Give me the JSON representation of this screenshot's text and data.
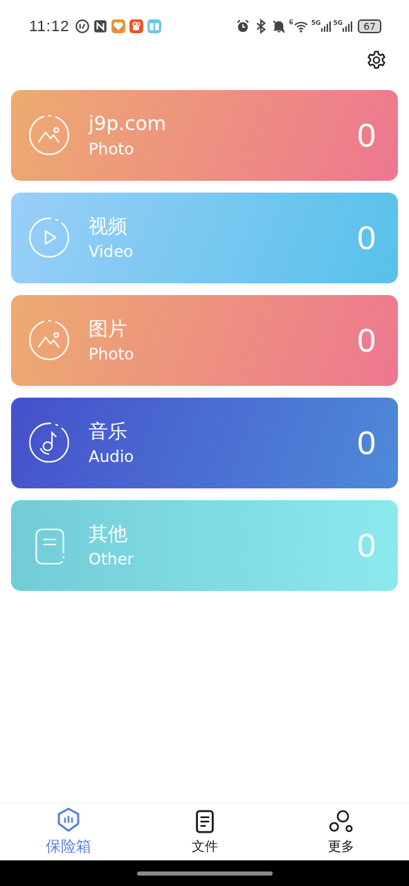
{
  "status_bar": {
    "time": "11:12",
    "wifi_label": "6",
    "signal_labels": [
      "5G",
      "5G"
    ],
    "battery": "67"
  },
  "cards": [
    {
      "kind": "photo",
      "title": "j9p.com",
      "subtitle": "Photo",
      "count": "0"
    },
    {
      "kind": "video",
      "title": "视频",
      "subtitle": "Video",
      "count": "0"
    },
    {
      "kind": "photo",
      "title": "图片",
      "subtitle": "Photo",
      "count": "0"
    },
    {
      "kind": "audio",
      "title": "音乐",
      "subtitle": "Audio",
      "count": "0"
    },
    {
      "kind": "other",
      "title": "其他",
      "subtitle": "Other",
      "count": "0"
    }
  ],
  "tabs": [
    {
      "kind": "vault",
      "label": "保险箱",
      "selected": true
    },
    {
      "kind": "files",
      "label": "文件",
      "selected": false
    },
    {
      "kind": "more",
      "label": "更多",
      "selected": false
    }
  ]
}
